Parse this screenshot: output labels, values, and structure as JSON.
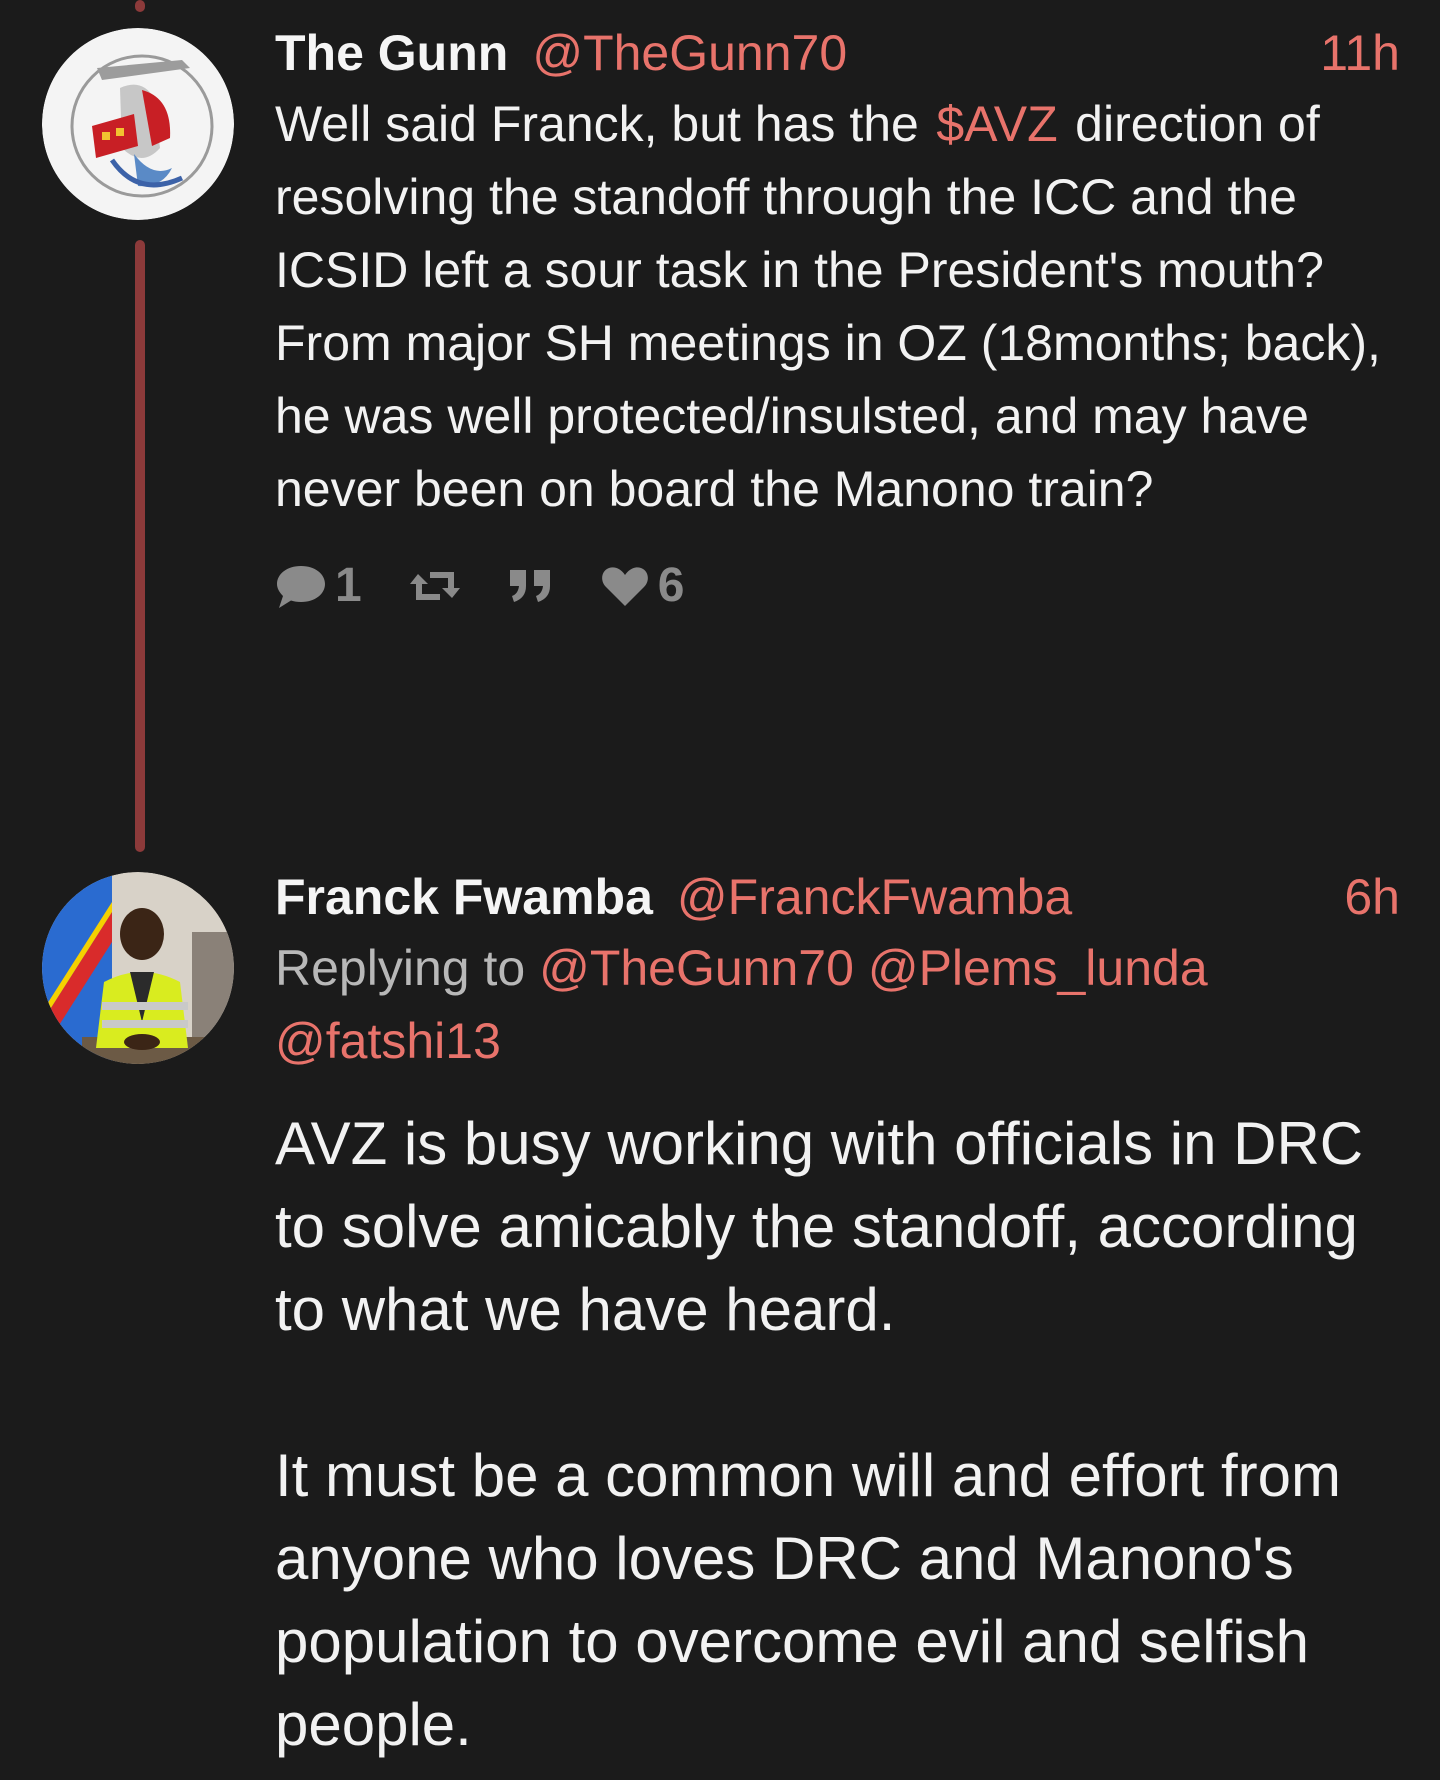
{
  "tweets": [
    {
      "display_name": "The Gunn",
      "handle": "@TheGunn70",
      "timestamp": "11h",
      "avatar_icon": "knight-crest-avatar",
      "body": {
        "part1": "Well said Franck, but has the",
        "ticker": "$AVZ",
        "part2": "direction of resolving the standoff through the ICC and the ICSID left a sour task in the President's mouth?",
        "part3": "From major SH meetings in OZ (18months; back), he was well protected/insulsted, and may have never been on board the Manono train?"
      },
      "actions": {
        "reply_count": "1",
        "retweet_count": "",
        "quote_count": "",
        "like_count": "6"
      }
    },
    {
      "display_name": "Franck Fwamba",
      "handle": "@FranckFwamba",
      "timestamp": "6h",
      "avatar_icon": "person-photo-avatar",
      "replying_to_label": "Replying to",
      "mentions": [
        "@TheGunn70",
        "@Plems_lunda",
        "@fatshi13"
      ],
      "body": {
        "para1": "AVZ is busy working with officials in DRC to solve amicably the standoff, according to what we have heard.",
        "para2": "It must be a common will and effort from anyone who loves DRC and Manono's population to overcome evil and selfish people."
      }
    }
  ],
  "colors": {
    "background": "#1b1b1b",
    "accent": "#e8736b",
    "thread_line": "#8c3a3a",
    "muted": "#8a8a8a"
  }
}
